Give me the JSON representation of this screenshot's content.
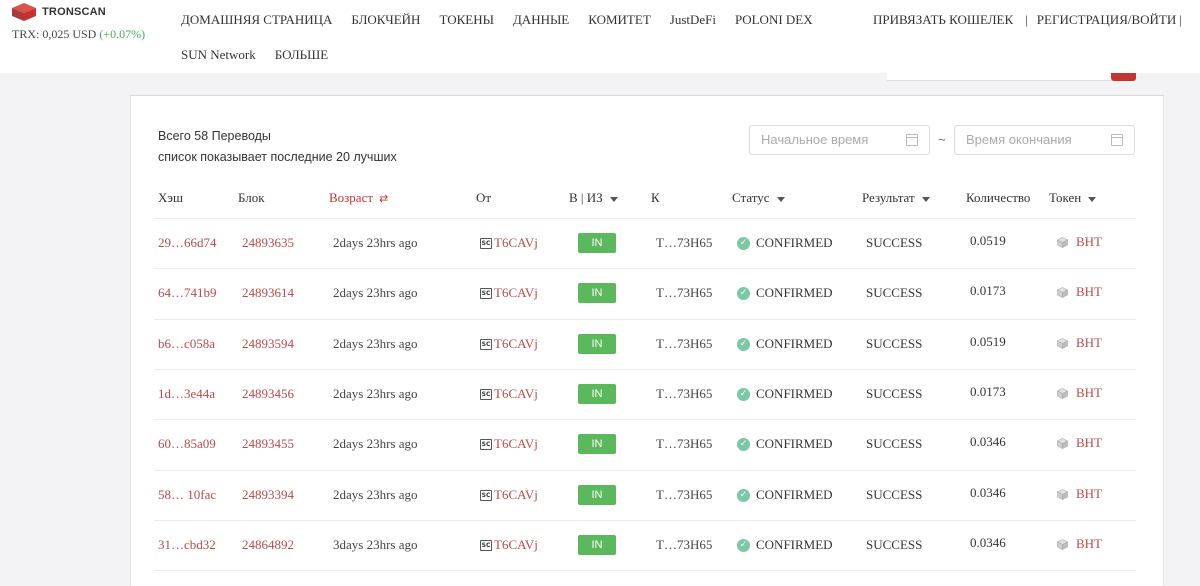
{
  "header": {
    "logo_text": "TRONSCAN",
    "price_label": "TRX: 0,025 USD",
    "price_change": "(+0.07%)",
    "nav_row1": [
      "ДОМАШНЯЯ СТРАНИЦА",
      "БЛОКЧЕЙН",
      "ТОКЕНЫ",
      "ДАННЫЕ",
      "КОМИТЕТ",
      "JustDeFi",
      "POLONI DEX"
    ],
    "nav_row2": [
      "SUN Network",
      "БОЛЬШЕ"
    ],
    "link_wallet": "ПРИВЯЗАТЬ КОШЕЛЕК",
    "divider": "|",
    "link_login": "РЕГИСТРАЦИЯ/ВОЙТИ"
  },
  "summary": {
    "total": "Всего 58 Переводы",
    "note": "список показывает последние 20 лучших"
  },
  "filters": {
    "start_placeholder": "Начальное время",
    "separator": "~",
    "end_placeholder": "Время окончания"
  },
  "table": {
    "columns": {
      "hash": "Хэш",
      "block": "Блок",
      "age": "Возраст",
      "from": "От",
      "direction": "В | ИЗ",
      "to": "К",
      "status": "Статус",
      "result": "Результат",
      "amount": "Количество",
      "token": "Токен"
    },
    "rows": [
      {
        "hash": "29…66d74",
        "block": "24893635",
        "age": "2days 23hrs ago",
        "from": "T6CAVj",
        "direction": "IN",
        "to": "T…73H65",
        "status": "CONFIRMED",
        "result": "SUCCESS",
        "amount": "0.0519",
        "token": "BHT"
      },
      {
        "hash": "64…741b9",
        "block": "24893614",
        "age": "2days 23hrs ago",
        "from": "T6CAVj",
        "direction": "IN",
        "to": "T…73H65",
        "status": "CONFIRMED",
        "result": "SUCCESS",
        "amount": "0.0173",
        "token": "BHT"
      },
      {
        "hash": "b6…c058a",
        "block": "24893594",
        "age": "2days 23hrs ago",
        "from": "T6CAVj",
        "direction": "IN",
        "to": "T…73H65",
        "status": "CONFIRMED",
        "result": "SUCCESS",
        "amount": "0.0519",
        "token": "BHT"
      },
      {
        "hash": "1d…3e44a",
        "block": "24893456",
        "age": "2days 23hrs ago",
        "from": "T6CAVj",
        "direction": "IN",
        "to": "T…73H65",
        "status": "CONFIRMED",
        "result": "SUCCESS",
        "amount": "0.0173",
        "token": "BHT"
      },
      {
        "hash": "60…85a09",
        "block": "24893455",
        "age": "2days 23hrs ago",
        "from": "T6CAVj",
        "direction": "IN",
        "to": "T…73H65",
        "status": "CONFIRMED",
        "result": "SUCCESS",
        "amount": "0.0346",
        "token": "BHT"
      },
      {
        "hash": "58… 10fac",
        "block": "24893394",
        "age": "2days 23hrs ago",
        "from": "T6CAVj",
        "direction": "IN",
        "to": "T…73H65",
        "status": "CONFIRMED",
        "result": "SUCCESS",
        "amount": "0.0346",
        "token": "BHT"
      },
      {
        "hash": "31…cbd32",
        "block": "24864892",
        "age": "3days 23hrs ago",
        "from": "T6CAVj",
        "direction": "IN",
        "to": "T…73H65",
        "status": "CONFIRMED",
        "result": "SUCCESS",
        "amount": "0.0346",
        "token": "BHT"
      }
    ]
  },
  "icons": {
    "logo": "tron-cube-logo",
    "calendar": "calendar-icon",
    "sort": "sort-icon",
    "filter": "caret-down-icon",
    "contract": "smart-contract-icon",
    "status": "check-circle-icon",
    "token": "token-cube-icon"
  },
  "colors": {
    "accent_red": "#c23631",
    "link_red": "#b94a48",
    "in_green": "#5cb85c",
    "confirmed_teal": "#7cc7a4",
    "price_up": "#3fae5a"
  }
}
